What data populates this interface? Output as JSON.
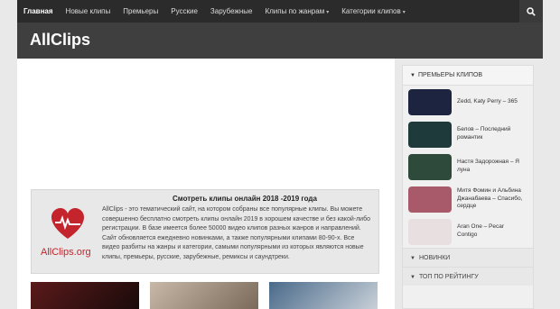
{
  "nav": {
    "items": [
      {
        "label": "Главная",
        "active": true,
        "dropdown": false
      },
      {
        "label": "Новые клипы",
        "active": false,
        "dropdown": false
      },
      {
        "label": "Премьеры",
        "active": false,
        "dropdown": false
      },
      {
        "label": "Русские",
        "active": false,
        "dropdown": false
      },
      {
        "label": "Зарубежные",
        "active": false,
        "dropdown": false
      },
      {
        "label": "Клипы по жанрам",
        "active": false,
        "dropdown": true
      },
      {
        "label": "Категории клипов",
        "active": false,
        "dropdown": true
      }
    ],
    "search_icon": "search-icon"
  },
  "header": {
    "logo": "AllClips"
  },
  "info": {
    "title": "Смотреть клипы онлайн 2018 -2019 года",
    "text": "AllClips - это тематический сайт, на котором собраны все популярные клипы. Вы можете совершенно бесплатно смотреть клипы онлайн 2019 в хорошем качестве и без какой-либо регистрации. В базе имеется более 50000 видео клипов разных жанров и направлений. Сайт обновляется ежедневно новинками, а также популярными клипами 80-90-х. Все видео разбиты на жанры и категории, самыми популярными из которых являются новые клипы, премьеры, русские, зарубежные, ремиксы и саундтреки.",
    "brand": "AllClips.org",
    "logo_icon": "heart-logo-icon"
  },
  "sidebar": {
    "header": "Премьеры клипов",
    "items": [
      {
        "title": "Zedd, Katy Perry – 365",
        "thumb_color": "#1c2440"
      },
      {
        "title": "Белов – Последний романтик",
        "thumb_color": "#1f3a3a"
      },
      {
        "title": "Настя Задорожная – Я луна",
        "thumb_color": "#2d4a3a"
      },
      {
        "title": "Митя Фомин и Альбина Джанабаева – Спасибо, сердце",
        "thumb_color": "#a85a6a"
      },
      {
        "title": "Aran One – Pecar Contigo",
        "thumb_color": "#e8e0e0"
      }
    ],
    "tabs": [
      "Новинки",
      "Топ по рейтингу"
    ]
  },
  "colors": {
    "nav_bg": "#2b2b2b",
    "header_bg": "#3f3f3f",
    "brand_red": "#c4252d"
  }
}
